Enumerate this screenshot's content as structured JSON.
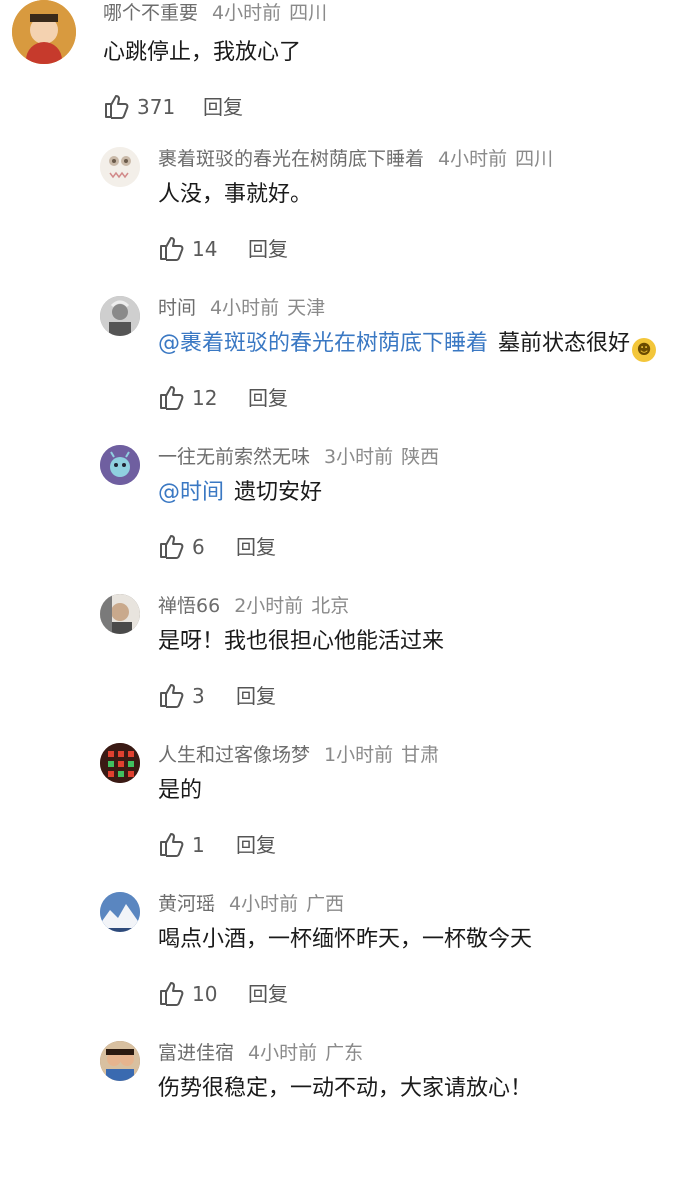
{
  "comments": [
    {
      "name": "哪个不重要",
      "time": "4小时前",
      "location": "四川",
      "mention": "",
      "text": "心跳停止，我放心了",
      "likes": "371",
      "reply_label": "回复",
      "avatar_color": "#e8a64b"
    },
    {
      "name": "裹着斑驳的春光在树荫底下睡着",
      "time": "4小时前",
      "location": "四川",
      "mention": "",
      "text": "人没，事就好。",
      "likes": "14",
      "reply_label": "回复",
      "avatar_color": "#f2eee8"
    },
    {
      "name": "时间",
      "time": "4小时前",
      "location": "天津",
      "mention": "@裹着斑驳的春光在树荫底下睡着",
      "text": "墓前状态很好",
      "likes": "12",
      "reply_label": "回复",
      "avatar_color": "#9a9a9a",
      "emoji": "grin-emoji"
    },
    {
      "name": "一往无前索然无味",
      "time": "3小时前",
      "location": "陕西",
      "mention": "@时间",
      "text": "遗切安好",
      "likes": "6",
      "reply_label": "回复",
      "avatar_color": "#7b6fa8"
    },
    {
      "name": "禅悟66",
      "time": "2小时前",
      "location": "北京",
      "mention": "",
      "text": "是呀！我也很担心他能活过来",
      "likes": "3",
      "reply_label": "回复",
      "avatar_color": "#6d6660"
    },
    {
      "name": "人生和过客像场梦",
      "time": "1小时前",
      "location": "甘肃",
      "mention": "",
      "text": "是的",
      "likes": "1",
      "reply_label": "回复",
      "avatar_color": "#4a1f1a"
    },
    {
      "name": "黄河瑶",
      "time": "4小时前",
      "location": "广西",
      "mention": "",
      "text": "喝点小酒，一杯缅怀昨天，一杯敬今天",
      "likes": "10",
      "reply_label": "回复",
      "avatar_color": "#6f93c4"
    },
    {
      "name": "富进佳宿",
      "time": "4小时前",
      "location": "广东",
      "mention": "",
      "text": "伤势很稳定，一动不动，大家请放心！",
      "likes": "",
      "reply_label": "",
      "avatar_color": "#8a6a4a"
    }
  ],
  "colors": {
    "mention": "#3a78c3",
    "meta": "#6d6d6d",
    "text": "#1a1a1a"
  }
}
